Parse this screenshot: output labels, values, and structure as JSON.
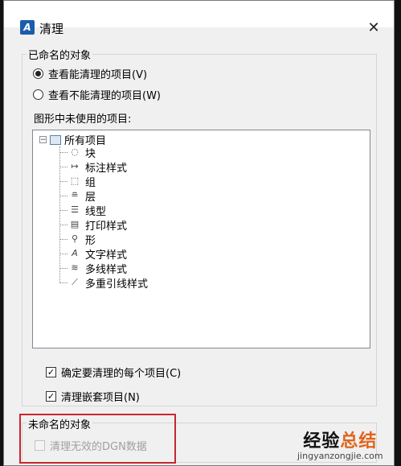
{
  "window": {
    "title": "清理",
    "close_glyph": "✕",
    "icon": "autocad-icon"
  },
  "named_group": {
    "label": "已命名的对象",
    "radio_purgeable": "查看能清理的项目(V)",
    "radio_nonpurgeable": "查看不能清理的项目(W)",
    "tree_label": "图形中未使用的项目:",
    "tree": {
      "root": "所有项目",
      "items": [
        {
          "label": "块",
          "icon": "block-icon"
        },
        {
          "label": "标注样式",
          "icon": "dimension-style-icon"
        },
        {
          "label": "组",
          "icon": "group-icon"
        },
        {
          "label": "层",
          "icon": "layer-icon"
        },
        {
          "label": "线型",
          "icon": "linetype-icon"
        },
        {
          "label": "打印样式",
          "icon": "plot-style-icon"
        },
        {
          "label": "形",
          "icon": "shape-icon"
        },
        {
          "label": "文字样式",
          "icon": "text-style-icon"
        },
        {
          "label": "多线样式",
          "icon": "multiline-style-icon"
        },
        {
          "label": "多重引线样式",
          "icon": "multileader-style-icon"
        }
      ]
    },
    "check_confirm": "确定要清理的每个项目(C)",
    "check_nested": "清理嵌套项目(N)"
  },
  "unnamed_group": {
    "label": "未命名的对象",
    "check_dgn": "清理无效的DGN数据"
  },
  "watermark": {
    "main_prefix": "经验",
    "main_accent": "总结",
    "url": "jingyanzongjie.com"
  },
  "colors": {
    "highlight_box": "#c7272d",
    "watermark_accent": "#e0651c",
    "app_icon": "#1c5cae"
  }
}
